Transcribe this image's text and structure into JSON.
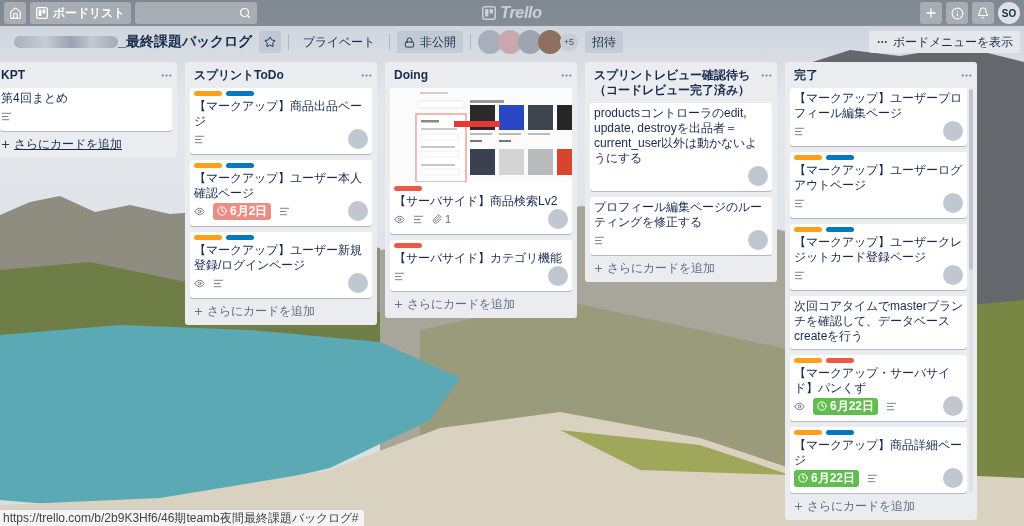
{
  "top_bar": {
    "boards_button": "ボードリスト",
    "logo": "Trello",
    "avatar_initials": "SO"
  },
  "board_header": {
    "title": "_最終課題バックログ",
    "team_visibility": "プライベート",
    "visibility": "非公開",
    "member_overflow": "+5",
    "invite_button": "招待",
    "menu_button": "ボードメニューを表示"
  },
  "lists": [
    {
      "title": "KPT",
      "scrolled": false,
      "cards": [
        {
          "title": "第4回まとめ",
          "cover": false,
          "member": false,
          "badges": [
            {
              "kind": "description"
            }
          ]
        }
      ],
      "add_card": {
        "label": "さらにカードを追加",
        "hovered": true
      }
    },
    {
      "title": "スプリントToDo",
      "scrolled": false,
      "cards": [
        {
          "labels": [
            {
              "color": "#ff9f1a"
            },
            {
              "color": "#0079bf"
            }
          ],
          "title": "【マークアップ】商品出品ページ",
          "cover": false,
          "member": true,
          "badges": [
            {
              "kind": "description"
            }
          ]
        },
        {
          "labels": [
            {
              "color": "#ff9f1a"
            },
            {
              "color": "#0079bf"
            }
          ],
          "title": "【マークアップ】ユーザー本人確認ページ",
          "cover": false,
          "member": true,
          "badges": [
            {
              "kind": "watch"
            },
            {
              "kind": "due",
              "text": "6月2日",
              "complete": false
            },
            {
              "kind": "description"
            }
          ]
        },
        {
          "labels": [
            {
              "color": "#ff9f1a"
            },
            {
              "color": "#0079bf"
            }
          ],
          "title": "【マークアップ】ユーザー新規登録/ログインページ",
          "cover": false,
          "member": true,
          "badges": [
            {
              "kind": "watch"
            },
            {
              "kind": "description"
            }
          ]
        }
      ],
      "add_card": {
        "label": "さらにカードを追加",
        "hovered": false
      }
    },
    {
      "title": "Doing",
      "scrolled": false,
      "cards": [
        {
          "labels": [
            {
              "color": "#eb5a46"
            }
          ],
          "title": "【サーバサイド】商品検索Lv2",
          "cover": true,
          "member": true,
          "badges": [
            {
              "kind": "watch"
            },
            {
              "kind": "description"
            },
            {
              "kind": "attachment",
              "text": "1"
            }
          ]
        },
        {
          "labels": [
            {
              "color": "#eb5a46"
            }
          ],
          "title": "【サーバサイド】カテゴリ機能",
          "cover": false,
          "member": true,
          "badges": [
            {
              "kind": "description"
            }
          ]
        }
      ],
      "add_card": {
        "label": "さらにカードを追加",
        "hovered": false
      }
    },
    {
      "title": "スプリントレビュー確認待ち（コードレビュー完了済み）",
      "scrolled": false,
      "cards": [
        {
          "title": "productsコントローラのedit, update, destroyを出品者＝current_user以外は動かないようにする",
          "cover": false,
          "member": true
        },
        {
          "title": "プロフィール編集ページのルーティングを修正する",
          "cover": false,
          "member": true,
          "badges": [
            {
              "kind": "description"
            }
          ]
        }
      ],
      "add_card": {
        "label": "さらにカードを追加",
        "hovered": false
      }
    },
    {
      "title": "完了",
      "scrolled": true,
      "cards": [
        {
          "title": "【マークアップ】ユーザープロフィール編集ページ",
          "cover": false,
          "member": true,
          "badges": [
            {
              "kind": "description"
            }
          ]
        },
        {
          "labels": [
            {
              "color": "#ff9f1a"
            },
            {
              "color": "#0079bf"
            }
          ],
          "title": "【マークアップ】ユーザーログアウトページ",
          "cover": false,
          "member": true,
          "badges": [
            {
              "kind": "description"
            }
          ]
        },
        {
          "labels": [
            {
              "color": "#ff9f1a"
            },
            {
              "color": "#0079bf"
            }
          ],
          "title": "【マークアップ】ユーザークレジットカード登録ページ",
          "cover": false,
          "member": true,
          "badges": [
            {
              "kind": "description"
            }
          ]
        },
        {
          "title": "次回コアタイムでmasterブランチを確認して、データベースcreateを行う",
          "cover": false,
          "member": false
        },
        {
          "labels": [
            {
              "color": "#ff9f1a"
            },
            {
              "color": "#eb5a46"
            }
          ],
          "title": "【マークアップ・サーバサイド】パンくず",
          "cover": false,
          "member": true,
          "badges": [
            {
              "kind": "watch"
            },
            {
              "kind": "due",
              "text": "6月22日",
              "complete": true
            },
            {
              "kind": "description"
            }
          ]
        },
        {
          "labels": [
            {
              "color": "#ff9f1a"
            },
            {
              "color": "#0079bf"
            }
          ],
          "title": "【マークアップ】商品詳細ページ",
          "cover": false,
          "member": true,
          "badges": [
            {
              "kind": "due",
              "text": "6月22日",
              "complete": true
            },
            {
              "kind": "description"
            }
          ]
        }
      ],
      "add_card": {
        "label": "さらにカードを追加",
        "hovered": false
      }
    }
  ],
  "status_bar": {
    "url": "https://trello.com/b/2b9K3Hf6/46期teamb夜間最終課題バックログ#"
  }
}
